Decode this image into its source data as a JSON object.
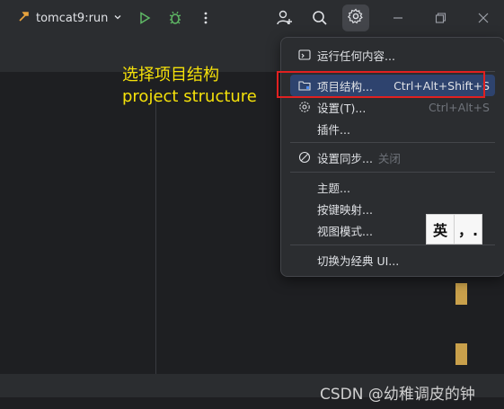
{
  "toolbar": {
    "run_config": "tomcat9:run",
    "icons": [
      "hammer-icon",
      "chevron-down-icon",
      "run-icon",
      "debug-icon",
      "more-vertical-icon",
      "add-user-icon",
      "search-icon",
      "settings-icon",
      "minimize-icon",
      "restore-icon",
      "close-icon"
    ]
  },
  "annotation": {
    "line1": "选择项目结构",
    "line2": "project structure"
  },
  "menu": {
    "items": [
      {
        "label": "运行任何内容...",
        "icon": "run-anything-icon",
        "shortcut": ""
      },
      {
        "label": "项目结构...",
        "icon": "project-structure-icon",
        "shortcut": "Ctrl+Alt+Shift+S",
        "selected": true
      },
      {
        "label": "设置(T)...",
        "icon": "settings-icon",
        "shortcut": "Ctrl+Alt+S"
      },
      {
        "label": "插件...",
        "icon": "",
        "shortcut": ""
      },
      {
        "label": "设置同步...",
        "icon": "disabled-icon",
        "suffix": "关闭"
      },
      {
        "label": "主题...",
        "shortcut": ""
      },
      {
        "label": "按键映射...",
        "shortcut": ""
      },
      {
        "label": "视图模式...",
        "shortcut": ""
      },
      {
        "label": "切换为经典 UI...",
        "shortcut": ""
      }
    ]
  },
  "ime": {
    "mode": "英",
    "punct": "，."
  },
  "watermark": "CSDN @幼稚调皮的钟",
  "colors": {
    "accent_selected": "#2e436e",
    "annotation": "#f5e10a",
    "highlight_box": "#e02020",
    "run": "#5fb865"
  }
}
